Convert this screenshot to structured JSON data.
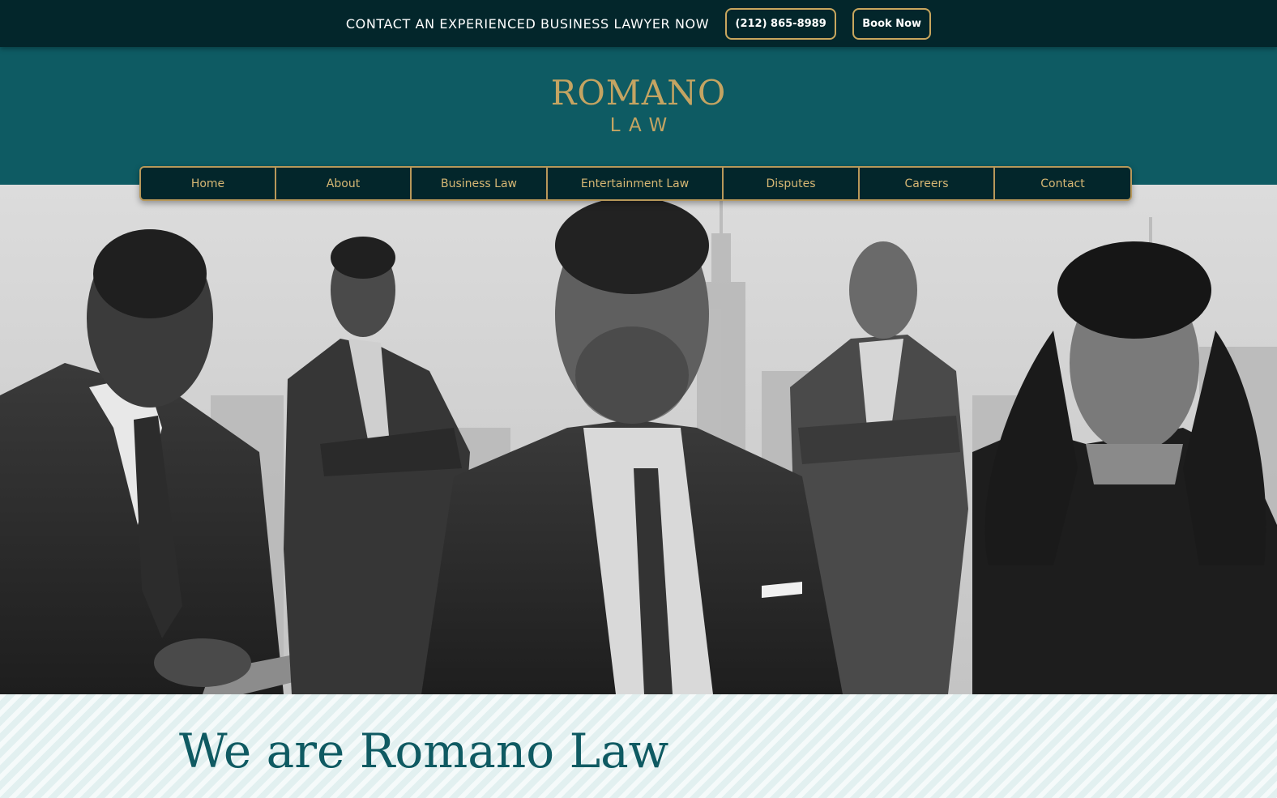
{
  "topbar": {
    "cta_text": "CONTACT AN EXPERIENCED BUSINESS LAWYER NOW",
    "phone_label": "(212) 865-8989",
    "book_label": "Book Now"
  },
  "logo": {
    "main": "ROMANO",
    "sub": "LAW"
  },
  "nav": {
    "items": [
      {
        "label": "Home"
      },
      {
        "label": "About"
      },
      {
        "label": "Business Law"
      },
      {
        "label": "Entertainment Law"
      },
      {
        "label": "Disputes"
      },
      {
        "label": "Careers"
      },
      {
        "label": "Contact"
      }
    ]
  },
  "intro": {
    "heading": "We are Romano Law"
  },
  "colors": {
    "topbar_bg": "#03262b",
    "header_bg": "#0e5b63",
    "gold": "#c4a462",
    "intro_bg": "#e9f5f5",
    "heading": "#0f5a62"
  }
}
